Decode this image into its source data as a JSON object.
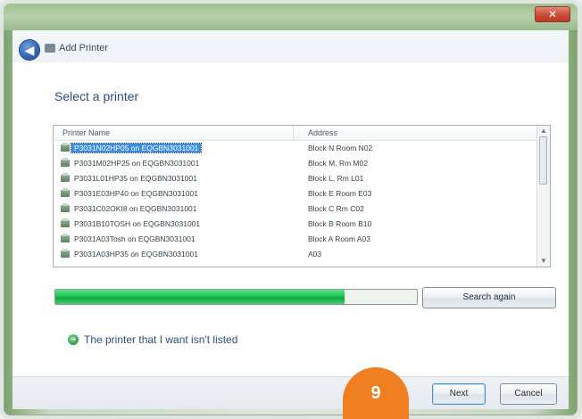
{
  "window": {
    "close_label": "✕",
    "wizard_title": "Add Printer"
  },
  "page": {
    "heading": "Select a printer",
    "columns": {
      "name": "Printer Name",
      "address": "Address"
    },
    "printers": [
      {
        "name": "P3031N02HP05 on EQGBN3031001",
        "address": "Block N Room N02",
        "selected": true
      },
      {
        "name": "P3031M02HP25 on EQGBN3031001",
        "address": "Block M, Rm M02"
      },
      {
        "name": "P3031L01HP35 on EQGBN3031001",
        "address": "Block L, Rm L01"
      },
      {
        "name": "P3031E03HP40 on EQGBN3031001",
        "address": "Block E Room E03"
      },
      {
        "name": "P3031C02OKI8 on EQGBN3031001",
        "address": "Block C Rm C02"
      },
      {
        "name": "P3031B10TOSH on EQGBN3031001",
        "address": "Block B Room B10"
      },
      {
        "name": "P3031A03Tosh on EQGBN3031001",
        "address": "Block A Room A03"
      },
      {
        "name": "P3031A03HP35 on EQGBN3031001",
        "address": "A03"
      }
    ],
    "search_progress": 0.8,
    "search_again": "Search again",
    "not_listed": "The printer that I want isn't listed"
  },
  "footer": {
    "next": "Next",
    "cancel": "Cancel"
  },
  "badge": {
    "number": "9"
  },
  "colors": {
    "selection": "#3a8de0",
    "progress": "#20c356",
    "badge": "#f07f22"
  },
  "icons": {
    "back": "back-arrow-icon",
    "printer": "printer-icon",
    "link": "arrow-right-icon",
    "close": "close-icon"
  }
}
